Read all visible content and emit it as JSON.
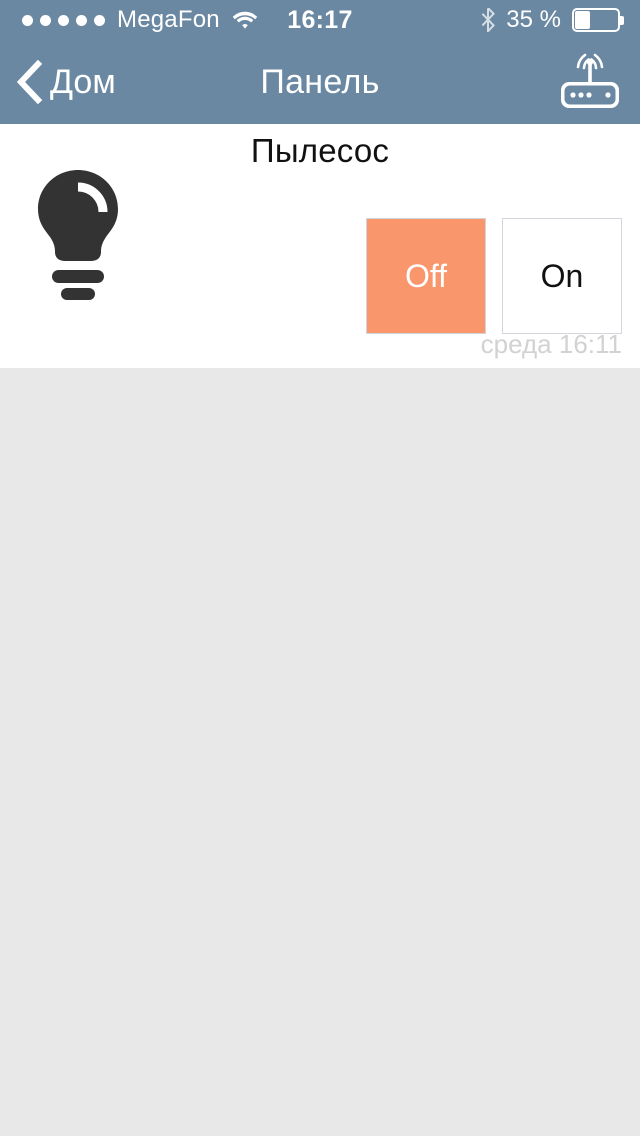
{
  "status_bar": {
    "signal_dots_total": 5,
    "signal_dots_filled": 5,
    "carrier": "MegaFon",
    "wifi_icon": "wifi-icon",
    "time": "16:17",
    "bluetooth_icon": "bluetooth-icon",
    "battery_percent_label": "35 %",
    "battery_level": 35,
    "battery_icon": "battery-icon"
  },
  "nav_bar": {
    "back_icon": "chevron-left-icon",
    "back_label": "Дом",
    "title": "Панель",
    "right_icon": "router-wifi-icon"
  },
  "device_card": {
    "title": "Пылесос",
    "device_icon": "lightbulb-icon",
    "buttons": [
      {
        "label": "Off",
        "state": "active"
      },
      {
        "label": "On",
        "state": "inactive"
      }
    ],
    "timestamp": "среда 16:11"
  },
  "colors": {
    "nav_background": "#6b88a2",
    "accent_active": "#f9966b",
    "page_background": "#e8e8e8",
    "card_background": "#ffffff",
    "icon_dark": "#333333",
    "timestamp_text": "#d2d2d2"
  }
}
